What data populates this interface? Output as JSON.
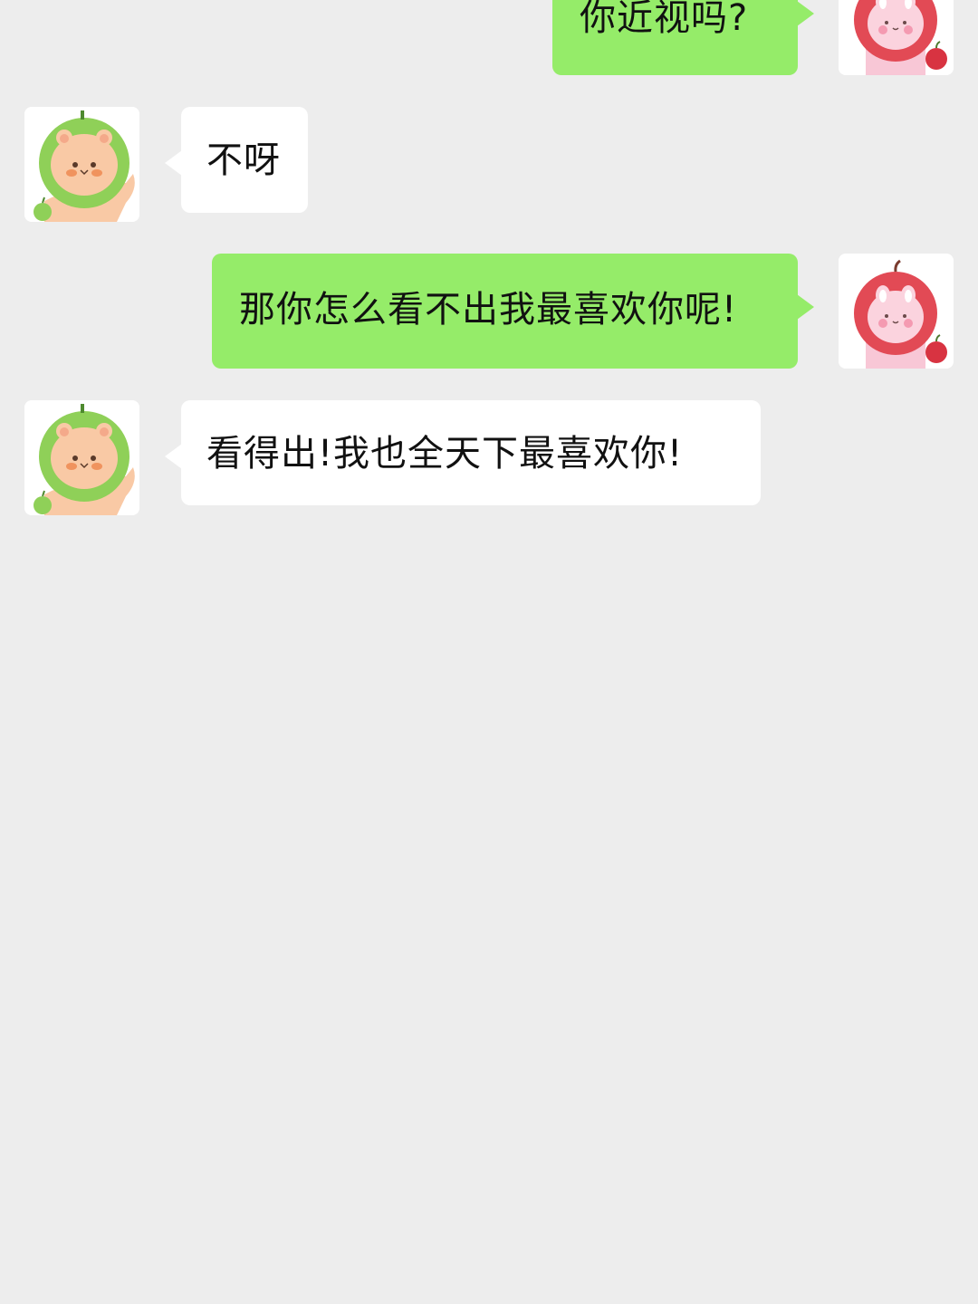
{
  "conversation": {
    "messages": [
      {
        "sender": "me",
        "avatar_icon": "red-apple-bunny-icon",
        "text": "你近视吗?"
      },
      {
        "sender": "other",
        "avatar_icon": "green-apple-bear-icon",
        "text": "不呀"
      },
      {
        "sender": "me",
        "avatar_icon": "red-apple-bunny-icon",
        "text": "那你怎么看不出我最喜欢你呢!"
      },
      {
        "sender": "other",
        "avatar_icon": "green-apple-bear-icon",
        "text": "看得出!我也全天下最喜欢你!"
      }
    ]
  },
  "colors": {
    "background": "#ededed",
    "sent_bubble": "#95ec69",
    "received_bubble": "#ffffff",
    "text": "#111111"
  }
}
